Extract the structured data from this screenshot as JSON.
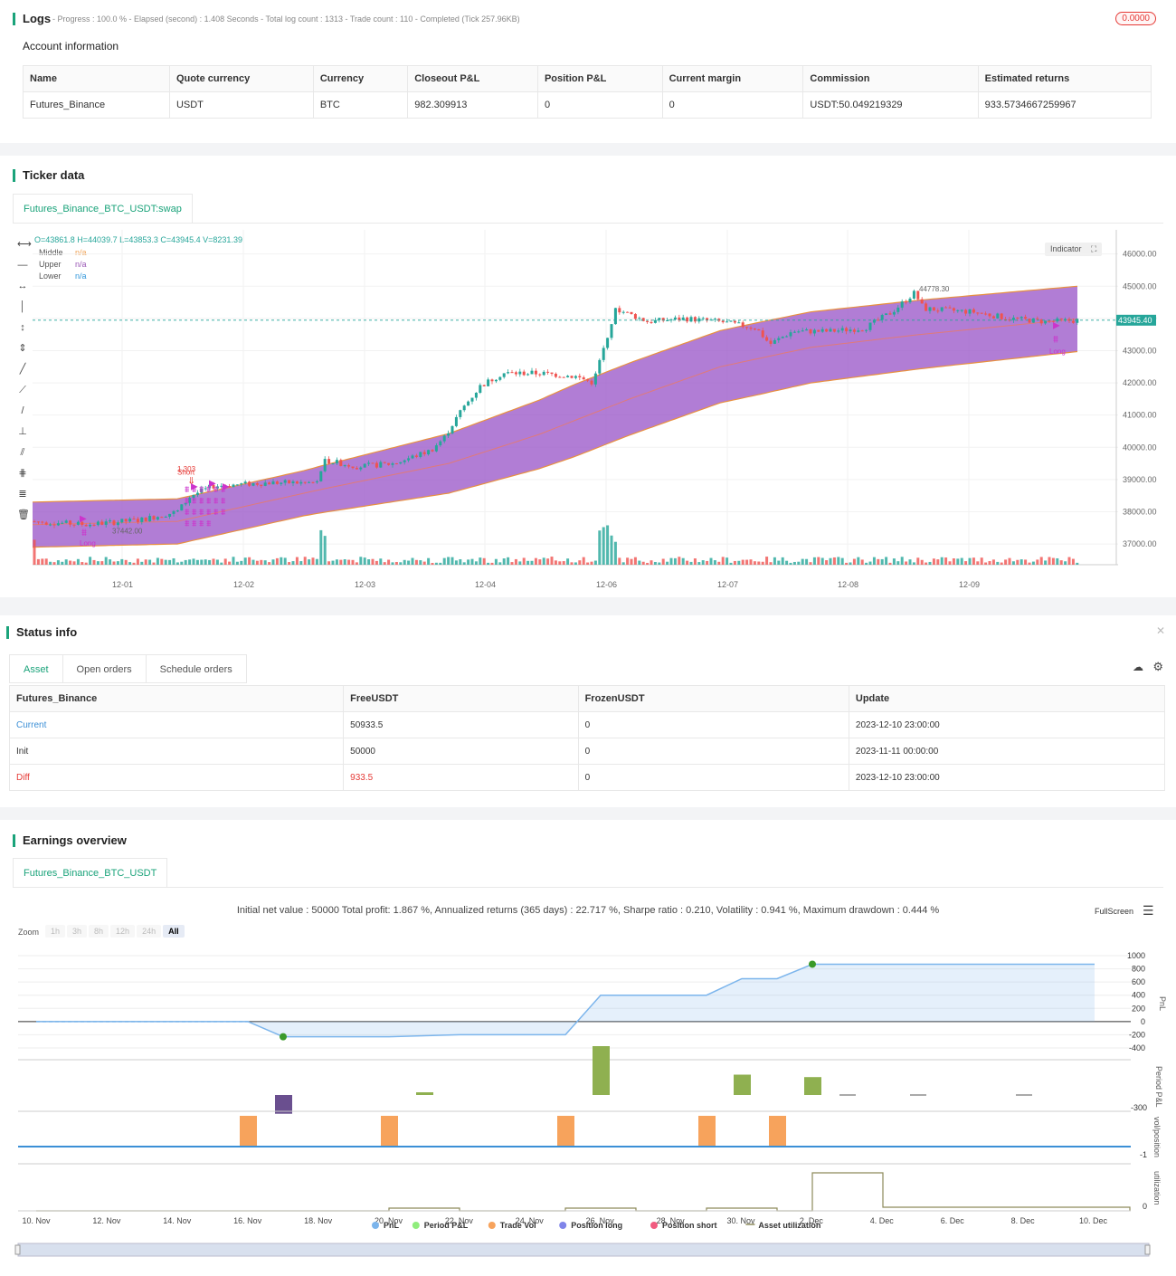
{
  "logs": {
    "title": "Logs",
    "status": "- Progress : 100.0 % - Elapsed (second) : 1.408  Seconds - Total log count : 1313 - Trade count : 110 - Completed (Tick 257.96KB)",
    "badge": "0.0000",
    "account_title": "Account information",
    "headers": [
      "Name",
      "Quote currency",
      "Currency",
      "Closeout P&L",
      "Position P&L",
      "Current margin",
      "Commission",
      "Estimated returns"
    ],
    "row": [
      "Futures_Binance",
      "USDT",
      "BTC",
      "982.309913",
      "0",
      "0",
      "USDT:50.049219329",
      "933.5734667259967"
    ]
  },
  "ticker": {
    "title": "Ticker data",
    "tab": "Futures_Binance_BTC_USDT:swap",
    "ohlc": "O=43861.8 H=44039.7 L=43853.3 C=43945.4 V=8231.39",
    "legend": [
      {
        "name": "Middle",
        "value": "n/a",
        "color": "#f0a050"
      },
      {
        "name": "Upper",
        "value": "n/a",
        "color": "#9b59b6"
      },
      {
        "name": "Lower",
        "value": "n/a",
        "color": "#3498db"
      }
    ],
    "indicator_btn": "Indicator",
    "price_ticks": [
      "46000.00",
      "45000.00",
      "44000.00",
      "43000.00",
      "42000.00",
      "41000.00",
      "40000.00",
      "39000.00",
      "38000.00",
      "37000.00"
    ],
    "date_ticks": [
      "12-01",
      "12-02",
      "12-03",
      "12-04",
      "12-06",
      "12-07",
      "12-08",
      "12-09"
    ],
    "current_price": "43945.40",
    "high_label": "44778.30",
    "low_label": "37442.00",
    "trade_labels": {
      "short_sell": "1.303",
      "short": "Short",
      "long1": "Long",
      "long2": "Long"
    },
    "colors": {
      "up": "#26a69a",
      "down": "#ef5350",
      "band": "#9b59c9",
      "accent": "#cc33cc"
    }
  },
  "status": {
    "title": "Status info",
    "tabs": [
      "Asset",
      "Open orders",
      "Schedule orders"
    ],
    "headers": [
      "Futures_Binance",
      "FreeUSDT",
      "FrozenUSDT",
      "Update"
    ],
    "rows": [
      {
        "name": "Current",
        "free": "50933.5",
        "frozen": "0",
        "update": "2023-12-10 23:00:00"
      },
      {
        "name": "Init",
        "free": "50000",
        "frozen": "0",
        "update": "2023-11-11 00:00:00"
      },
      {
        "name": "Diff",
        "free": "933.5",
        "frozen": "0",
        "update": "2023-12-10 23:00:00"
      }
    ]
  },
  "earnings": {
    "title": "Earnings overview",
    "tab": "Futures_Binance_BTC_USDT",
    "summary": "Initial net value : 50000  Total profit: 1.867 %, Annualized returns (365 days) : 22.717 %, Sharpe ratio : 0.210, Volatility : 0.941 %, Maximum drawdown : 0.444 %",
    "fullscreen": "FullScreen",
    "zoom_label": "Zoom",
    "zoom_buttons": [
      "1h",
      "3h",
      "8h",
      "12h",
      "24h",
      "All"
    ],
    "pnl_ticks": [
      "1000",
      "800",
      "600",
      "400",
      "200",
      "0",
      "-200",
      "-400"
    ],
    "period_tick": "-300",
    "vol_tick": "-1",
    "util_tick": "0",
    "axis_titles": [
      "PnL",
      "Period P&L",
      "vol/position",
      "utilization"
    ],
    "date_ticks": [
      "10. Nov",
      "12. Nov",
      "14. Nov",
      "16. Nov",
      "18. Nov",
      "20. Nov",
      "22. Nov",
      "24. Nov",
      "26. Nov",
      "28. Nov",
      "30. Nov",
      "2. Dec",
      "4. Dec",
      "6. Dec",
      "8. Dec",
      "10. Dec"
    ],
    "legend": [
      {
        "name": "PnL",
        "color": "#7cb5ec"
      },
      {
        "name": "Period P&L",
        "color": "#90ed7d"
      },
      {
        "name": "Trade Vol",
        "color": "#f7a35c"
      },
      {
        "name": "Position long",
        "color": "#8085e9"
      },
      {
        "name": "Position short",
        "color": "#f15c80"
      },
      {
        "name": "Asset utilization",
        "color": "#8d8a5a"
      }
    ]
  },
  "chart_data": [
    {
      "type": "line",
      "title": "",
      "series": [
        {
          "name": "PnL",
          "x": [
            "2023-11-10",
            "2023-11-16",
            "2023-11-17",
            "2023-11-20",
            "2023-11-22",
            "2023-11-25",
            "2023-11-26",
            "2023-11-29",
            "2023-11-30",
            "2023-12-01",
            "2023-12-02",
            "2023-12-06",
            "2023-12-10"
          ],
          "values": [
            0,
            0,
            -230,
            -230,
            -200,
            -200,
            400,
            400,
            650,
            650,
            870,
            870,
            870
          ]
        }
      ],
      "ylim": [
        -400,
        1000
      ]
    },
    {
      "type": "bar",
      "series": [
        {
          "name": "Period P&L",
          "x": [
            "2023-11-17",
            "2023-11-21",
            "2023-11-26",
            "2023-11-30",
            "2023-12-02"
          ],
          "values": [
            -230,
            30,
            600,
            250,
            220
          ]
        }
      ]
    },
    {
      "type": "bar",
      "series": [
        {
          "name": "Trade Vol",
          "x": [
            "2023-11-16",
            "2023-11-20",
            "2023-11-25",
            "2023-11-29",
            "2023-12-01"
          ],
          "values": [
            1,
            1,
            1,
            1,
            1
          ]
        }
      ]
    }
  ]
}
